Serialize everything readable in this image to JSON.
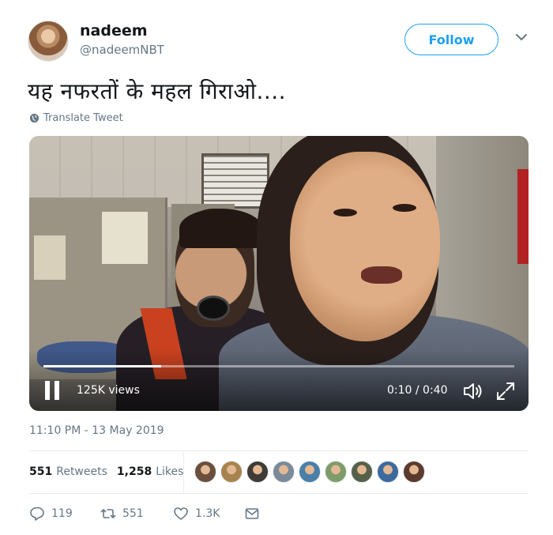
{
  "user": {
    "name": "nadeem",
    "handle": "@nadeemNBT"
  },
  "header": {
    "follow_label": "Follow"
  },
  "tweet": {
    "text": "यह नफरतों के महल गिराओ....",
    "translate_label": "Translate Tweet",
    "timestamp": "11:10 PM - 13 May 2019"
  },
  "video": {
    "views": "125K views",
    "time": "0:10 / 0:40",
    "progress_fraction": 0.25
  },
  "stats": {
    "retweets_count": "551",
    "retweets_label": "Retweets",
    "likes_count": "1,258",
    "likes_label": "Likes"
  },
  "likers": [
    {
      "color": "#6b4f3e"
    },
    {
      "color": "#a9834f"
    },
    {
      "color": "#3f3b36"
    },
    {
      "color": "#7a8a99"
    },
    {
      "color": "#4a7fa8"
    },
    {
      "color": "#7e9c6a"
    },
    {
      "color": "#56614a"
    },
    {
      "color": "#3c6a9e"
    },
    {
      "color": "#5c3b2e"
    }
  ],
  "actions": {
    "reply_count": "119",
    "retweet_count": "551",
    "like_count": "1.3K"
  },
  "colors": {
    "accent": "#1da1f2",
    "secondary_text": "#657786"
  },
  "icons": [
    "chevron-down-icon",
    "globe-icon",
    "pause-icon",
    "volume-icon",
    "fullscreen-icon",
    "reply-icon",
    "retweet-icon",
    "heart-icon",
    "mail-icon"
  ]
}
